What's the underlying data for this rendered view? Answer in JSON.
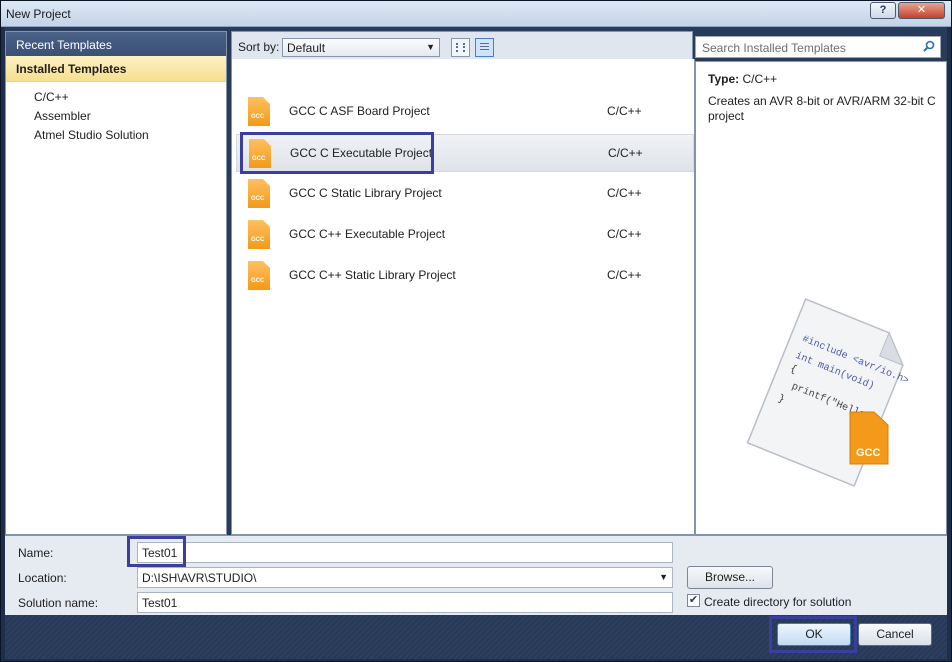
{
  "window": {
    "title": "New Project",
    "help_label": "?",
    "close_label": "✕"
  },
  "left": {
    "recent_label": "Recent Templates",
    "installed_label": "Installed Templates",
    "tree": [
      "C/C++",
      "Assembler",
      "Atmel Studio Solution"
    ]
  },
  "toolbar": {
    "sort_label": "Sort by:",
    "sort_value": "Default"
  },
  "templates": [
    {
      "name": "GCC C ASF Board Project",
      "type": "C/C++",
      "icon": "gcc-file-icon"
    },
    {
      "name": "GCC C Executable Project",
      "type": "C/C++",
      "icon": "gcc-file-icon"
    },
    {
      "name": "GCC C Static Library Project",
      "type": "C/C++",
      "icon": "gcc-file-icon"
    },
    {
      "name": "GCC C++ Executable Project",
      "type": "C/C++",
      "icon": "gcc-file-icon"
    },
    {
      "name": "GCC C++ Static Library Project",
      "type": "C/C++",
      "icon": "gcc-file-icon"
    }
  ],
  "icon_text": "GCC",
  "selected_template_index": 1,
  "search": {
    "placeholder": "Search Installed Templates"
  },
  "details": {
    "type_label": "Type:",
    "type_value": "C/C++",
    "description": "Creates an AVR 8-bit or AVR/ARM 32-bit C project",
    "preview_code": [
      "#include <avr/io.h>",
      "int main(void)",
      "{",
      "printf(\"Hello",
      "}"
    ],
    "preview_badge": "GCC"
  },
  "form": {
    "name_label": "Name:",
    "name_value": "Test01",
    "location_label": "Location:",
    "location_value": "D:\\ISH\\AVR\\STUDIO\\",
    "solution_label": "Solution name:",
    "solution_value": "Test01",
    "browse_label": "Browse...",
    "create_dir_label": "Create directory for solution",
    "create_dir_checked": true
  },
  "buttons": {
    "ok_label": "OK",
    "cancel_label": "Cancel"
  },
  "colors": {
    "accent_highlight": "#3a3f9e",
    "icon_orange": "#f29a18",
    "frame": "#293b5a"
  }
}
